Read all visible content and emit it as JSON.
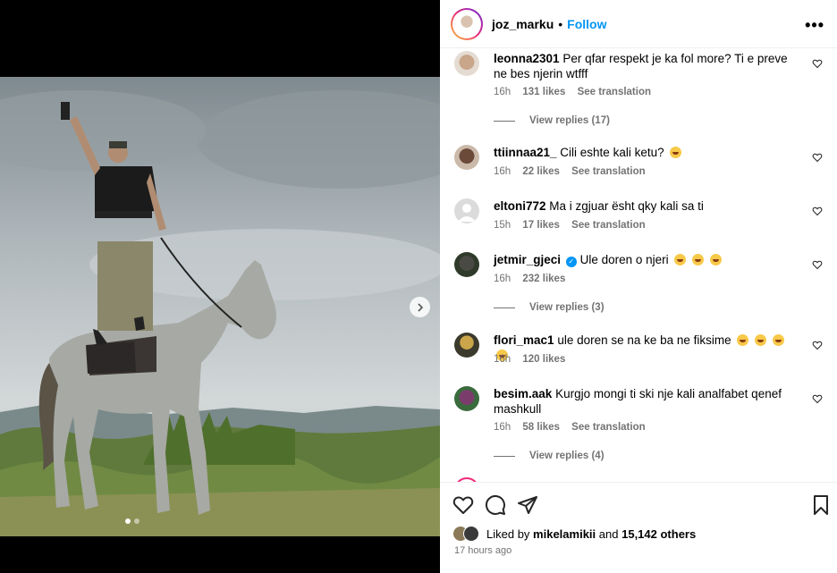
{
  "header": {
    "username": "joz_marku",
    "separator": "•",
    "follow_label": "Follow",
    "more_icon": "more-horizontal-icon"
  },
  "comments": [
    {
      "username": "leonna2301",
      "text": "Per qfar respekt je ka fol more? Ti e preve ne bes njerin wtfff",
      "time": "16h",
      "likes": "131 likes",
      "translate": "See translation",
      "replies": "View replies (17)"
    },
    {
      "username": "ttiinnaa21_",
      "text": "Cili eshte kali ketu?",
      "time": "16h",
      "likes": "22 likes",
      "translate": "See translation",
      "replies": ""
    },
    {
      "username": "eltoni772",
      "text": "Ma i zgjuar ësht qky kali sa ti",
      "time": "15h",
      "likes": "17 likes",
      "translate": "See translation",
      "replies": ""
    },
    {
      "username": "jetmir_gjeci",
      "text": "Ule doren o njeri",
      "time": "16h",
      "likes": "232 likes",
      "translate": "",
      "replies": "View replies (3)"
    },
    {
      "username": "flori_mac1",
      "text": "ule doren se na ke ba ne fiksime",
      "time": "16h",
      "likes": "120 likes",
      "translate": "",
      "replies": ""
    },
    {
      "username": "besim.aak",
      "text": "Kurgjo mongi ti ski nje kali analfabet qenef mashkull",
      "time": "16h",
      "likes": "58 likes",
      "translate": "See translation",
      "replies": "View replies (4)"
    }
  ],
  "footer": {
    "liked_prefix": "Liked by",
    "liked_user": "mikelamikii",
    "liked_and": "and",
    "liked_others": "15,142 others",
    "posted": "17 hours ago"
  },
  "colors": {
    "accent": "#0095f6",
    "muted": "#737373",
    "border": "#efefef"
  },
  "icons": [
    "heart-icon",
    "comment-icon",
    "share-icon",
    "bookmark-icon",
    "chevron-right-icon"
  ]
}
